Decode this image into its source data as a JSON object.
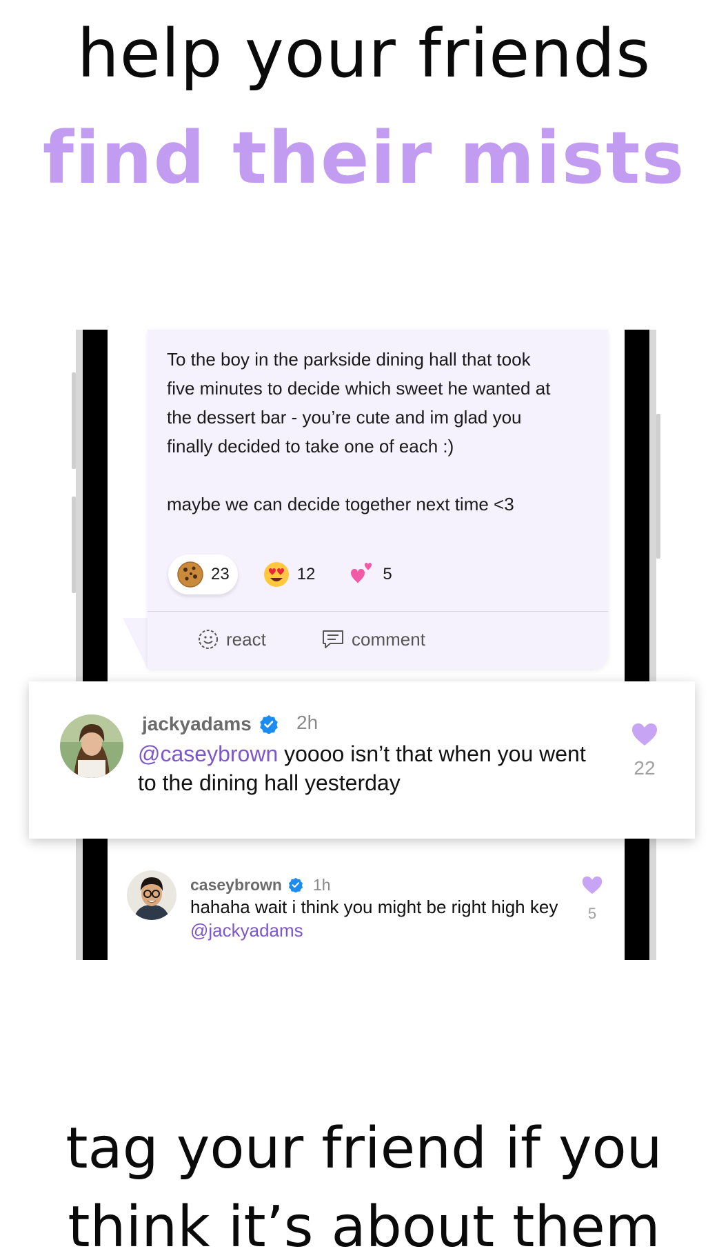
{
  "headline": {
    "line1": "help your friends",
    "line2": "find their mists"
  },
  "post": {
    "paragraph1_lines": [
      "To the boy in the parkside dining hall that took",
      "five minutes to decide which sweet he wanted at",
      "the dessert bar - you’re cute and im glad you",
      "finally decided to take one of each :)"
    ],
    "paragraph2": "maybe we can decide together next time <3",
    "reactions": [
      {
        "emoji": "cookie",
        "count": "23",
        "selected": true
      },
      {
        "emoji": "heart-eyes",
        "count": "12",
        "selected": false
      },
      {
        "emoji": "two-hearts",
        "count": "5",
        "selected": false
      }
    ],
    "actions": {
      "react_label": "react",
      "comment_label": "comment"
    }
  },
  "highlighted_comment": {
    "username": "jackyadams",
    "verified": true,
    "time": "2h",
    "mention": "@caseybrown",
    "text_line1": " yoooo isn’t that when you went",
    "text_line2": "to the dining hall yesterday",
    "likes": "22"
  },
  "reply": {
    "username": "caseybrown",
    "verified": true,
    "time": "1h",
    "text": "hahaha wait i think you might be right high key",
    "mention": "@jackyadams",
    "likes": "5"
  },
  "footer": {
    "line1": "tag your friend if you",
    "line2": "think it’s about them"
  },
  "colors": {
    "accent_purple": "#c29cf0",
    "mention_purple": "#7d57c9",
    "heart_purple": "#c8a4f4",
    "verified_blue": "#1d8cf0",
    "post_background": "#f6f2fd"
  }
}
